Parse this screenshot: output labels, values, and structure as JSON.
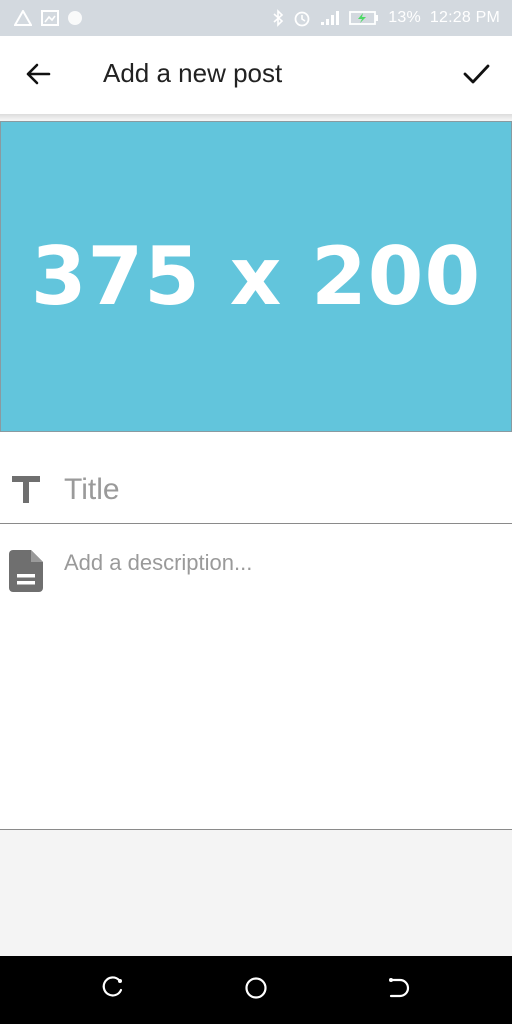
{
  "status_bar": {
    "battery_percent": "13%",
    "time": "12:28 PM",
    "icons": [
      "warning-icon",
      "image-icon",
      "circle-icon",
      "bluetooth-icon",
      "alarm-icon",
      "signal-icon",
      "battery-icon"
    ]
  },
  "app_bar": {
    "title": "Add a new post",
    "back_icon": "arrow-left-icon",
    "confirm_icon": "check-icon"
  },
  "image": {
    "placeholder_text": "375 x 200",
    "background": "#62c5dc"
  },
  "form": {
    "title_placeholder": "Title",
    "title_value": "",
    "title_icon": "text-format-icon",
    "description_placeholder": "Add a description...",
    "description_value": "",
    "description_icon": "document-icon"
  },
  "nav_bar": {
    "buttons": [
      "recent-apps-icon",
      "home-icon",
      "back-icon"
    ]
  }
}
